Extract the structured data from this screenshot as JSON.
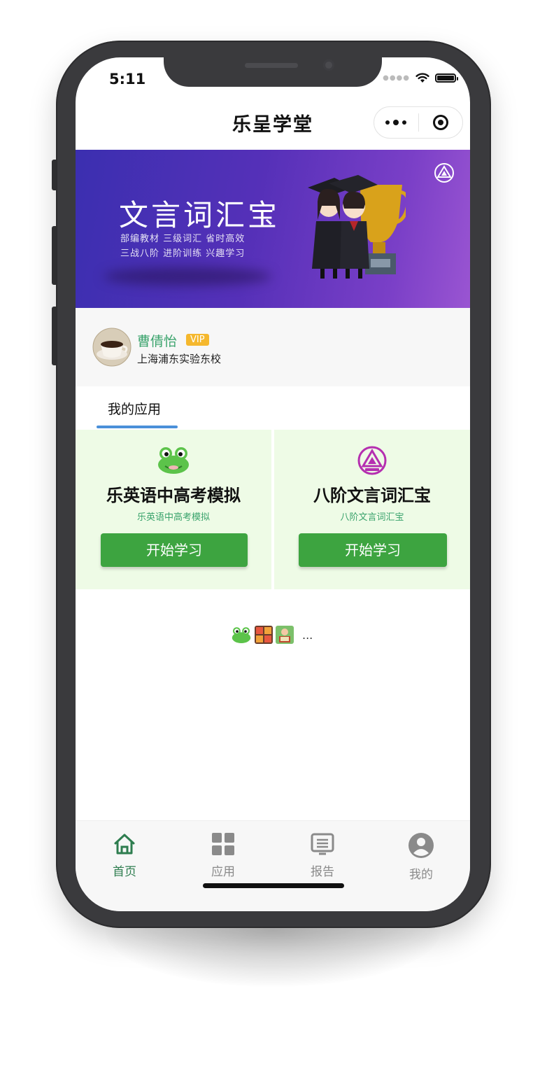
{
  "status_bar": {
    "time": "5:11"
  },
  "nav": {
    "title": "乐呈学堂",
    "more_icon": "more-dots-icon",
    "close_icon": "target-close-icon"
  },
  "banner": {
    "title": "文言词汇宝",
    "subtitle_line1": "部编教材 三级词汇 省时高效",
    "subtitle_line2": "三战八阶 进阶训练 兴趣学习",
    "logo_icon": "baijie-triangle-logo-icon",
    "art": "graduates-with-trophy"
  },
  "user": {
    "name": "曹倩怡",
    "badge": "VIP",
    "school": "上海浦东实验东校",
    "avatar": "coffee-cup-avatar"
  },
  "section": {
    "tab_label": "我的应用"
  },
  "apps": [
    {
      "name": "乐英语中高考模拟",
      "subtitle": "乐英语中高考模拟",
      "button": "开始学习",
      "icon": "frog-icon"
    },
    {
      "name": "八阶文言词汇宝",
      "subtitle": "八阶文言词汇宝",
      "button": "开始学习",
      "icon": "baijie-triangle-logo-icon"
    }
  ],
  "more_apps": {
    "ellipsis": "...",
    "icons": [
      "frog-icon",
      "math-tiles-icon",
      "reading-kid-icon"
    ]
  },
  "tabbar": {
    "items": [
      {
        "label": "首页",
        "icon": "home-icon",
        "active": true
      },
      {
        "label": "应用",
        "icon": "grid-icon",
        "active": false
      },
      {
        "label": "报告",
        "icon": "report-icon",
        "active": false
      },
      {
        "label": "我的",
        "icon": "user-icon",
        "active": false
      }
    ]
  },
  "colors": {
    "banner_start": "#3b2fb0",
    "banner_end": "#9a55d2",
    "accent_green": "#3da440",
    "text_green": "#3aa36c",
    "vip": "#f5b82e",
    "tab_indicator": "#4a90d9",
    "card_bg": "#eefbe6"
  }
}
